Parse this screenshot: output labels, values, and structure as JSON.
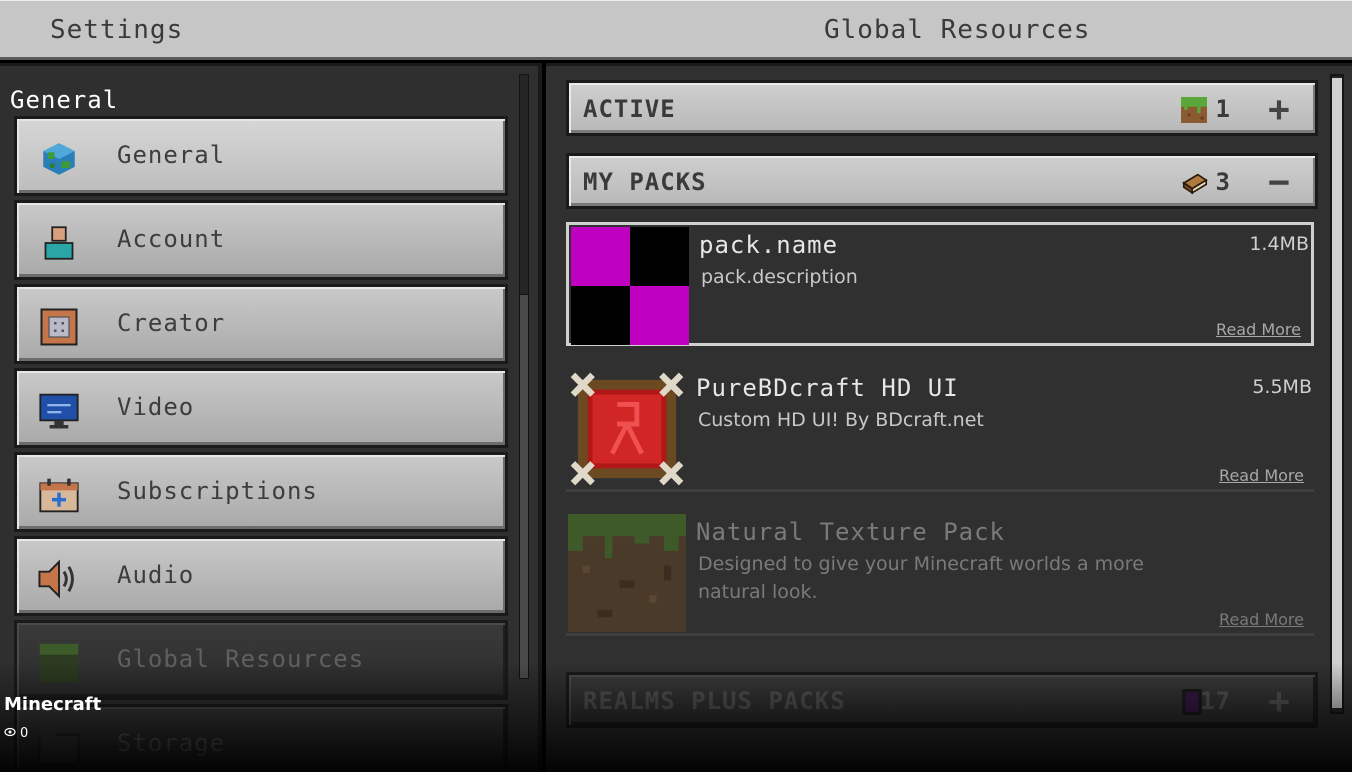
{
  "header": {
    "title": "Settings",
    "right_title": "Global Resources"
  },
  "sidebar": {
    "section_label": "General",
    "items": [
      {
        "label": "General",
        "icon": "globe-icon"
      },
      {
        "label": "Account",
        "icon": "account-icon"
      },
      {
        "label": "Creator",
        "icon": "creator-icon"
      },
      {
        "label": "Video",
        "icon": "monitor-icon"
      },
      {
        "label": "Subscriptions",
        "icon": "calendar-plus-icon"
      },
      {
        "label": "Audio",
        "icon": "speaker-icon"
      },
      {
        "label": "Global Resources",
        "icon": "grass-block-icon"
      },
      {
        "label": "Storage",
        "icon": "folder-icon"
      }
    ]
  },
  "sections": {
    "active": {
      "title": "ACTIVE",
      "count": "1",
      "toggle": "+"
    },
    "my_packs": {
      "title": "MY PACKS",
      "count": "3",
      "toggle": "−"
    },
    "realms": {
      "title": "REALMS PLUS PACKS",
      "count": "17",
      "toggle": "+"
    }
  },
  "packs": [
    {
      "name": "pack.name",
      "description": "pack.description",
      "size": "1.4MB",
      "read_more": "Read More"
    },
    {
      "name": "PureBDcraft HD UI",
      "description": "Custom HD UI! By BDcraft.net",
      "size": "5.5MB",
      "read_more": "Read More"
    },
    {
      "name": "Natural Texture Pack",
      "description": "Designed to give your Minecraft worlds a more natural look.",
      "size": "",
      "read_more": "Read More"
    }
  ],
  "overlay": {
    "app_name": "Minecraft",
    "views": "0"
  },
  "colors": {
    "missing_texture": "#c000c0",
    "panel": "#303030",
    "button": "#c6c6c6"
  }
}
